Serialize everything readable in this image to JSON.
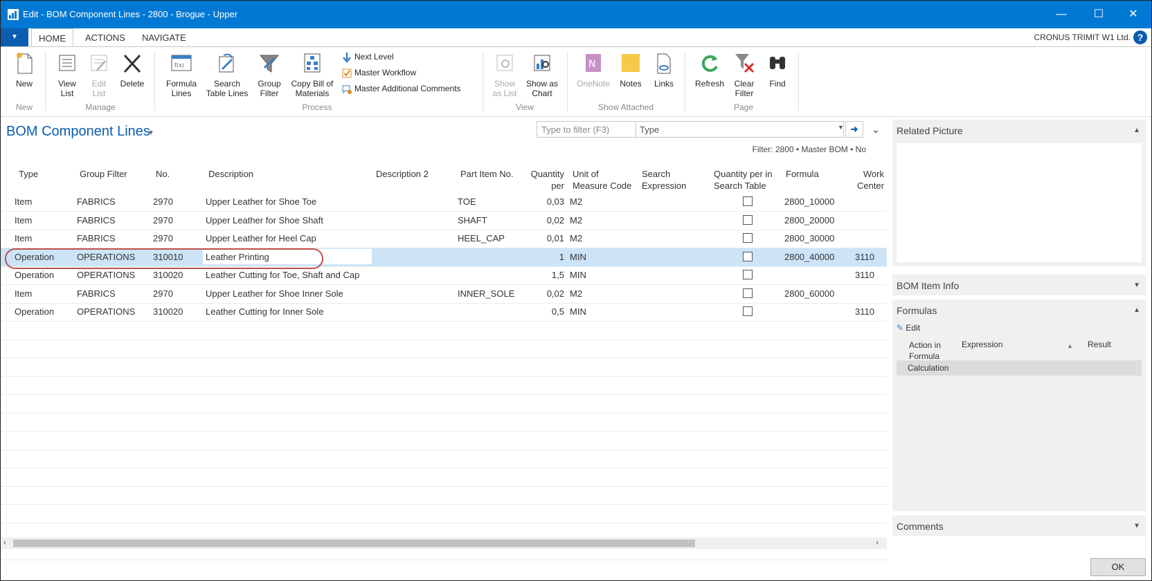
{
  "window": {
    "title": "Edit - BOM Component Lines - 2800 - Brogue - Upper",
    "minimize": "—",
    "maximize": "☐",
    "close": "✕"
  },
  "tabs": [
    "HOME",
    "ACTIONS",
    "NAVIGATE"
  ],
  "file_tab": "▼",
  "company": "CRONUS TRIMIT W1 Ltd.",
  "help": "?",
  "ribbon": {
    "new": [
      "New"
    ],
    "view_list": [
      "View",
      "List"
    ],
    "edit_list": [
      "Edit",
      "List"
    ],
    "delete": [
      "Delete"
    ],
    "formula_lines": [
      "Formula",
      "Lines"
    ],
    "search_table_lines": [
      "Search",
      "Table Lines"
    ],
    "group_filter": [
      "Group",
      "Filter"
    ],
    "copy_bom": [
      "Copy Bill of",
      "Materials"
    ],
    "next_level": "Next Level",
    "master_workflow": "Master Workflow",
    "master_additional_comments": "Master Additional Comments",
    "show_as_list": [
      "Show",
      "as List"
    ],
    "show_as_chart": [
      "Show as",
      "Chart"
    ],
    "onenote": [
      "OneNote"
    ],
    "notes": [
      "Notes"
    ],
    "links": [
      "Links"
    ],
    "refresh": [
      "Refresh"
    ],
    "clear_filter": [
      "Clear",
      "Filter"
    ],
    "find": [
      "Find"
    ],
    "groups": {
      "new": "New",
      "manage": "Manage",
      "process": "Process",
      "view": "View",
      "show_attached": "Show Attached",
      "page": "Page"
    }
  },
  "page": {
    "title": "BOM Component Lines",
    "filter_placeholder": "Type to filter (F3)",
    "filter_field": "Type",
    "filter_status": "Filter: 2800 • Master BOM • No"
  },
  "grid": {
    "headers": {
      "type": [
        "Type"
      ],
      "group_filter": [
        "Group Filter"
      ],
      "no": [
        "No."
      ],
      "description": [
        "Description"
      ],
      "description2": [
        "Description 2"
      ],
      "part_item_no": [
        "Part Item No."
      ],
      "qty_per": [
        "Quantity",
        "per"
      ],
      "uom": [
        "Unit of",
        "Measure Code"
      ],
      "search_expr": [
        "Search",
        "Expression"
      ],
      "qty_search_table": [
        "Quantity per in",
        "Search Table"
      ],
      "formula": [
        "Formula"
      ],
      "work_center": [
        "Work",
        "Center"
      ]
    },
    "rows": [
      {
        "type": "Item",
        "group": "FABRICS",
        "no": "2970",
        "desc": "Upper Leather for Shoe Toe",
        "part": "TOE",
        "qty": "0,03",
        "uom": "M2",
        "formula": "2800_10000",
        "wc": ""
      },
      {
        "type": "Item",
        "group": "FABRICS",
        "no": "2970",
        "desc": "Upper Leather for Shoe Shaft",
        "part": "SHAFT",
        "qty": "0,02",
        "uom": "M2",
        "formula": "2800_20000",
        "wc": ""
      },
      {
        "type": "Item",
        "group": "FABRICS",
        "no": "2970",
        "desc": "Upper Leather for Heel Cap",
        "part": "HEEL_CAP",
        "qty": "0,01",
        "uom": "M2",
        "formula": "2800_30000",
        "wc": ""
      },
      {
        "type": "Operation",
        "group": "OPERATIONS",
        "no": "310010",
        "desc": "Leather Printing",
        "part": "",
        "qty": "1",
        "uom": "MIN",
        "formula": "2800_40000",
        "wc": "3110"
      },
      {
        "type": "Operation",
        "group": "OPERATIONS",
        "no": "310020",
        "desc": "Leather Cutting for Toe, Shaft and Cap",
        "part": "",
        "qty": "1,5",
        "uom": "MIN",
        "formula": "",
        "wc": "3110"
      },
      {
        "type": "Item",
        "group": "FABRICS",
        "no": "2970",
        "desc": "Upper Leather for Shoe Inner Sole",
        "part": "INNER_SOLE",
        "qty": "0,02",
        "uom": "M2",
        "formula": "2800_60000",
        "wc": ""
      },
      {
        "type": "Operation",
        "group": "OPERATIONS",
        "no": "310020",
        "desc": "Leather Cutting for Inner Sole",
        "part": "",
        "qty": "0,5",
        "uom": "MIN",
        "formula": "",
        "wc": "3110"
      }
    ],
    "selected_row": 3
  },
  "factbox": {
    "related_picture": "Related Picture",
    "bom_item_info": "BOM Item Info",
    "formulas": "Formulas",
    "edit": "Edit",
    "formula_headers": {
      "action": [
        "Action in",
        "Formula"
      ],
      "expression": "Expression",
      "result": "Result"
    },
    "formula_row": "Calculation",
    "comments": "Comments"
  },
  "ok": "OK",
  "colors": {
    "accent": "#0078d4",
    "selection": "#cde4f7",
    "highlight_oval": "#c0504d"
  }
}
